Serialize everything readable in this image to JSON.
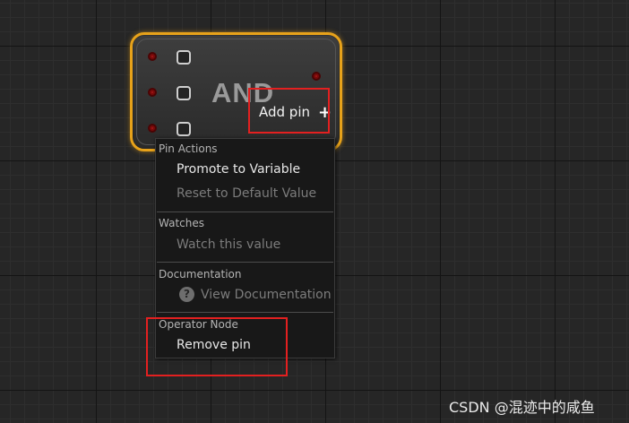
{
  "node": {
    "title": "AND",
    "add_pin_label": "Add pin",
    "add_pin_icon": "+",
    "pin_color": "#7a0a0a",
    "border_color": "#e7a21a"
  },
  "context_menu": {
    "pin_actions": {
      "header": "Pin Actions",
      "promote": "Promote to Variable",
      "reset": "Reset to Default Value"
    },
    "watches": {
      "header": "Watches",
      "watch": "Watch this value"
    },
    "documentation": {
      "header": "Documentation",
      "help_icon": "?",
      "view": "View Documentation"
    },
    "operator_node": {
      "header": "Operator Node",
      "remove": "Remove pin"
    }
  },
  "highlight_color": "#e32020",
  "watermark": "CSDN @混迹中的咸鱼"
}
